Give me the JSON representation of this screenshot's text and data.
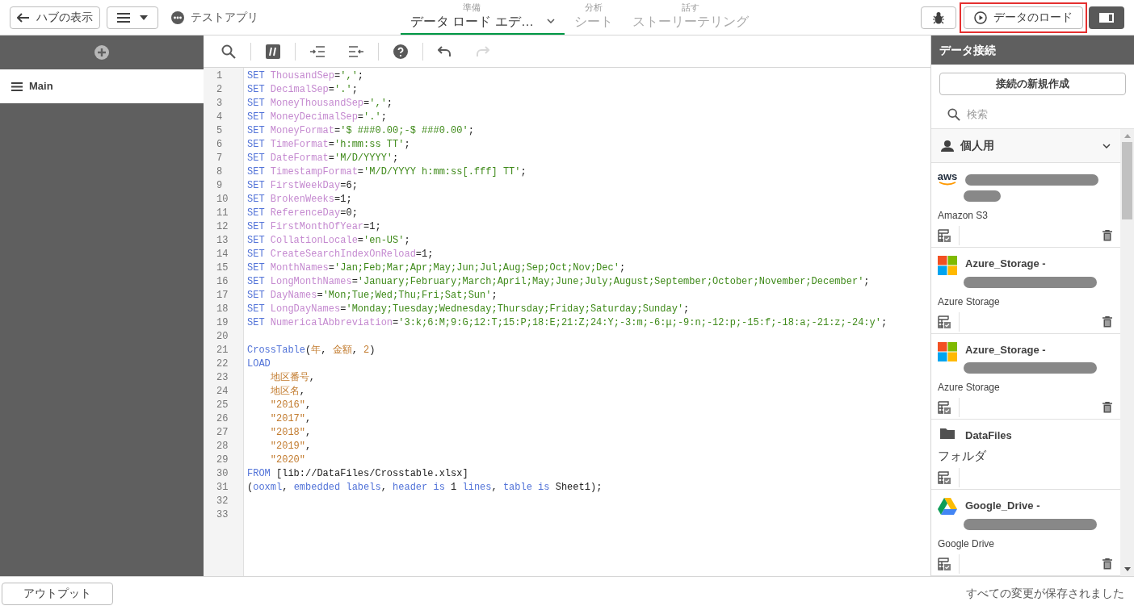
{
  "header": {
    "hub_button": "ハブの表示",
    "app_name": "テストアプリ",
    "tabs": [
      {
        "caption": "準備",
        "label": "データ ロード エデ…",
        "selected": true,
        "dropdown": true
      },
      {
        "caption": "分析",
        "label": "シート",
        "selected": false,
        "dropdown": false
      },
      {
        "caption": "話す",
        "label": "ストーリーテリング",
        "selected": false,
        "dropdown": false
      }
    ],
    "load_button": {
      "label": "データのロード",
      "highlighted": true
    }
  },
  "sections": {
    "items": [
      {
        "label": "Main",
        "selected": true
      }
    ]
  },
  "toolbar": {
    "redo_disabled": true
  },
  "code": [
    {
      "number": "1",
      "tokens": [
        {
          "kind": "kw",
          "text": "SET "
        },
        {
          "kind": "var",
          "text": "ThousandSep"
        },
        {
          "kind": "plain",
          "text": "="
        },
        {
          "kind": "str",
          "text": "','"
        },
        {
          "kind": "plain",
          "text": ";"
        }
      ]
    },
    {
      "number": "2",
      "tokens": [
        {
          "kind": "kw",
          "text": "SET "
        },
        {
          "kind": "var",
          "text": "DecimalSep"
        },
        {
          "kind": "plain",
          "text": "="
        },
        {
          "kind": "str",
          "text": "'.'"
        },
        {
          "kind": "plain",
          "text": ";"
        }
      ]
    },
    {
      "number": "3",
      "tokens": [
        {
          "kind": "kw",
          "text": "SET "
        },
        {
          "kind": "var",
          "text": "MoneyThousandSep"
        },
        {
          "kind": "plain",
          "text": "="
        },
        {
          "kind": "str",
          "text": "','"
        },
        {
          "kind": "plain",
          "text": ";"
        }
      ]
    },
    {
      "number": "4",
      "tokens": [
        {
          "kind": "kw",
          "text": "SET "
        },
        {
          "kind": "var",
          "text": "MoneyDecimalSep"
        },
        {
          "kind": "plain",
          "text": "="
        },
        {
          "kind": "str",
          "text": "'.'"
        },
        {
          "kind": "plain",
          "text": ";"
        }
      ]
    },
    {
      "number": "5",
      "tokens": [
        {
          "kind": "kw",
          "text": "SET "
        },
        {
          "kind": "var",
          "text": "MoneyFormat"
        },
        {
          "kind": "plain",
          "text": "="
        },
        {
          "kind": "str",
          "text": "'$ ###0.00;-$ ###0.00'"
        },
        {
          "kind": "plain",
          "text": ";"
        }
      ]
    },
    {
      "number": "6",
      "tokens": [
        {
          "kind": "kw",
          "text": "SET "
        },
        {
          "kind": "var",
          "text": "TimeFormat"
        },
        {
          "kind": "plain",
          "text": "="
        },
        {
          "kind": "str",
          "text": "'h:mm:ss TT'"
        },
        {
          "kind": "plain",
          "text": ";"
        }
      ]
    },
    {
      "number": "7",
      "tokens": [
        {
          "kind": "kw",
          "text": "SET "
        },
        {
          "kind": "var",
          "text": "DateFormat"
        },
        {
          "kind": "plain",
          "text": "="
        },
        {
          "kind": "str",
          "text": "'M/D/YYYY'"
        },
        {
          "kind": "plain",
          "text": ";"
        }
      ]
    },
    {
      "number": "8",
      "tokens": [
        {
          "kind": "kw",
          "text": "SET "
        },
        {
          "kind": "var",
          "text": "TimestampFormat"
        },
        {
          "kind": "plain",
          "text": "="
        },
        {
          "kind": "str",
          "text": "'M/D/YYYY h:mm:ss[.fff] TT'"
        },
        {
          "kind": "plain",
          "text": ";"
        }
      ]
    },
    {
      "number": "9",
      "tokens": [
        {
          "kind": "kw",
          "text": "SET "
        },
        {
          "kind": "var",
          "text": "FirstWeekDay"
        },
        {
          "kind": "plain",
          "text": "=6;"
        }
      ]
    },
    {
      "number": "10",
      "tokens": [
        {
          "kind": "kw",
          "text": "SET "
        },
        {
          "kind": "var",
          "text": "BrokenWeeks"
        },
        {
          "kind": "plain",
          "text": "=1;"
        }
      ]
    },
    {
      "number": "11",
      "tokens": [
        {
          "kind": "kw",
          "text": "SET "
        },
        {
          "kind": "var",
          "text": "ReferenceDay"
        },
        {
          "kind": "plain",
          "text": "=0;"
        }
      ]
    },
    {
      "number": "12",
      "tokens": [
        {
          "kind": "kw",
          "text": "SET "
        },
        {
          "kind": "var",
          "text": "FirstMonthOfYear"
        },
        {
          "kind": "plain",
          "text": "=1;"
        }
      ]
    },
    {
      "number": "13",
      "tokens": [
        {
          "kind": "kw",
          "text": "SET "
        },
        {
          "kind": "var",
          "text": "CollationLocale"
        },
        {
          "kind": "plain",
          "text": "="
        },
        {
          "kind": "str",
          "text": "'en-US'"
        },
        {
          "kind": "plain",
          "text": ";"
        }
      ]
    },
    {
      "number": "14",
      "tokens": [
        {
          "kind": "kw",
          "text": "SET "
        },
        {
          "kind": "var",
          "text": "CreateSearchIndexOnReload"
        },
        {
          "kind": "plain",
          "text": "=1;"
        }
      ]
    },
    {
      "number": "15",
      "tokens": [
        {
          "kind": "kw",
          "text": "SET "
        },
        {
          "kind": "var",
          "text": "MonthNames"
        },
        {
          "kind": "plain",
          "text": "="
        },
        {
          "kind": "str",
          "text": "'Jan;Feb;Mar;Apr;May;Jun;Jul;Aug;Sep;Oct;Nov;Dec'"
        },
        {
          "kind": "plain",
          "text": ";"
        }
      ]
    },
    {
      "number": "16",
      "tokens": [
        {
          "kind": "kw",
          "text": "SET "
        },
        {
          "kind": "var",
          "text": "LongMonthNames"
        },
        {
          "kind": "plain",
          "text": "="
        },
        {
          "kind": "str",
          "text": "'January;February;March;April;May;June;July;August;September;October;November;December'"
        },
        {
          "kind": "plain",
          "text": ";"
        }
      ]
    },
    {
      "number": "17",
      "tokens": [
        {
          "kind": "kw",
          "text": "SET "
        },
        {
          "kind": "var",
          "text": "DayNames"
        },
        {
          "kind": "plain",
          "text": "="
        },
        {
          "kind": "str",
          "text": "'Mon;Tue;Wed;Thu;Fri;Sat;Sun'"
        },
        {
          "kind": "plain",
          "text": ";"
        }
      ]
    },
    {
      "number": "18",
      "tokens": [
        {
          "kind": "kw",
          "text": "SET "
        },
        {
          "kind": "var",
          "text": "LongDayNames"
        },
        {
          "kind": "plain",
          "text": "="
        },
        {
          "kind": "str",
          "text": "'Monday;Tuesday;Wednesday;Thursday;Friday;Saturday;Sunday'"
        },
        {
          "kind": "plain",
          "text": ";"
        }
      ]
    },
    {
      "number": "19",
      "tokens": [
        {
          "kind": "kw",
          "text": "SET "
        },
        {
          "kind": "var",
          "text": "NumericalAbbreviation"
        },
        {
          "kind": "plain",
          "text": "="
        },
        {
          "kind": "str",
          "text": "'3:k;6:M;9:G;12:T;15:P;18:E;21:Z;24:Y;-3:m;-6:μ;-9:n;-12:p;-15:f;-18:a;-21:z;-24:y'"
        },
        {
          "kind": "plain",
          "text": ";"
        }
      ]
    },
    {
      "number": "20"
    },
    {
      "number": "21",
      "tokens": [
        {
          "kind": "kw",
          "text": "CrossTable"
        },
        {
          "kind": "plain",
          "text": "("
        },
        {
          "kind": "field",
          "text": "年"
        },
        {
          "kind": "plain",
          "text": ", "
        },
        {
          "kind": "field",
          "text": "金額"
        },
        {
          "kind": "plain",
          "text": ", "
        },
        {
          "kind": "field",
          "text": "2"
        },
        {
          "kind": "plain",
          "text": ")"
        }
      ]
    },
    {
      "number": "22",
      "tokens": [
        {
          "kind": "kw",
          "text": "LOAD"
        }
      ]
    },
    {
      "number": "23",
      "tokens": [
        {
          "kind": "field",
          "text": "    地区番号"
        },
        {
          "kind": "plain",
          "text": ","
        }
      ]
    },
    {
      "number": "24",
      "tokens": [
        {
          "kind": "field",
          "text": "    地区名"
        },
        {
          "kind": "plain",
          "text": ","
        }
      ]
    },
    {
      "number": "25",
      "tokens": [
        {
          "kind": "field",
          "text": "    \"2016\""
        },
        {
          "kind": "plain",
          "text": ","
        }
      ]
    },
    {
      "number": "26",
      "tokens": [
        {
          "kind": "field",
          "text": "    \"2017\""
        },
        {
          "kind": "plain",
          "text": ","
        }
      ]
    },
    {
      "number": "27",
      "tokens": [
        {
          "kind": "field",
          "text": "    \"2018\""
        },
        {
          "kind": "plain",
          "text": ","
        }
      ]
    },
    {
      "number": "28",
      "tokens": [
        {
          "kind": "field",
          "text": "    \"2019\""
        },
        {
          "kind": "plain",
          "text": ","
        }
      ]
    },
    {
      "number": "29",
      "tokens": [
        {
          "kind": "field",
          "text": "    \"2020\""
        }
      ]
    },
    {
      "number": "30",
      "tokens": [
        {
          "kind": "kw",
          "text": "FROM"
        },
        {
          "kind": "plain",
          "text": " [lib://DataFiles/Crosstable.xlsx]"
        }
      ]
    },
    {
      "number": "31",
      "tokens": [
        {
          "kind": "plain",
          "text": "("
        },
        {
          "kind": "kw",
          "text": "ooxml"
        },
        {
          "kind": "plain",
          "text": ", "
        },
        {
          "kind": "kw",
          "text": "embedded labels"
        },
        {
          "kind": "plain",
          "text": ", "
        },
        {
          "kind": "kw",
          "text": "header is"
        },
        {
          "kind": "plain",
          "text": " 1 "
        },
        {
          "kind": "kw",
          "text": "lines"
        },
        {
          "kind": "plain",
          "text": ", "
        },
        {
          "kind": "kw",
          "text": "table is"
        },
        {
          "kind": "plain",
          "text": " Sheet1);"
        }
      ]
    },
    {
      "number": "32"
    },
    {
      "number": "33"
    }
  ],
  "connections_panel": {
    "title": "データ接続",
    "create_button": "接続の新規作成",
    "search_placeholder": "検索",
    "group": {
      "label": "個人用",
      "expanded": true
    },
    "connections": [
      {
        "kind": "aws",
        "logo_text": "aws",
        "redacted": true,
        "type": "Amazon S3",
        "deletable": true
      },
      {
        "kind": "azure",
        "name": "Azure_Storage -",
        "redacted": true,
        "type": "Azure Storage",
        "deletable": true
      },
      {
        "kind": "azure",
        "name": "Azure_Storage -",
        "redacted": true,
        "type": "Azure Storage",
        "deletable": true
      },
      {
        "kind": "folder",
        "name": "DataFiles",
        "redacted": false,
        "type": "フォルダ",
        "deletable": false
      },
      {
        "kind": "gdrive",
        "name": "Google_Drive -",
        "redacted": true,
        "type": "Google Drive",
        "deletable": true
      }
    ]
  },
  "footer": {
    "output_button": "アウトプット",
    "status": "すべての変更が保存されました"
  }
}
